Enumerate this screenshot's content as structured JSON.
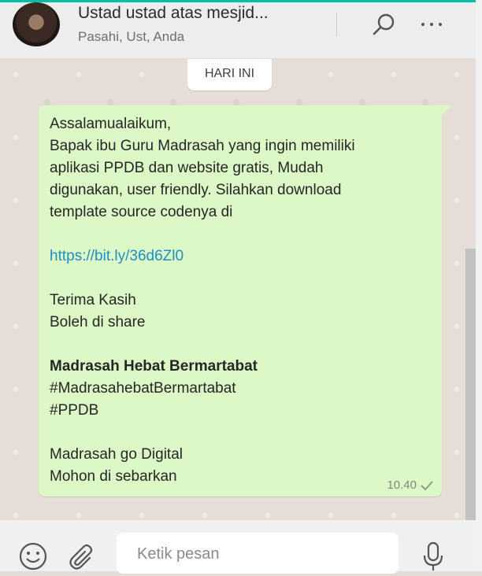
{
  "header": {
    "title": "Ustad ustad atas mesjid...",
    "subtitle": "Pasahi, Ust, Anda",
    "icons": [
      "avatar",
      "search-icon",
      "more-options-icon"
    ]
  },
  "chat": {
    "date_chip": "HARI INI",
    "message": {
      "lines": [
        "Assalamualaikum,",
        "Bapak ibu Guru Madrasah yang ingin memiliki",
        "aplikasi PPDB dan website gratis, Mudah",
        "digunakan, user friendly. Silahkan download",
        "template source codenya di",
        "",
        "https://bit.ly/36d6Zl0",
        "",
        "Terima Kasih",
        "Boleh di share",
        "",
        "Madrasah Hebat Bermartabat",
        "#MadrasahebatBermartabat",
        "#PPDB",
        "",
        "Madrasah go Digital",
        "Mohon di sebarkan"
      ],
      "time": "10.40",
      "status_icon": "single-check-icon"
    }
  },
  "footer": {
    "input_placeholder": "Ketik pesan",
    "icons": [
      "emoji-icon",
      "attach-icon",
      "mic-icon"
    ]
  },
  "colors": {
    "accent": "#00bfa5",
    "bubble": "#dcf8c6",
    "link": "#1f8fc2",
    "chat_bg": "#e6ded6"
  }
}
